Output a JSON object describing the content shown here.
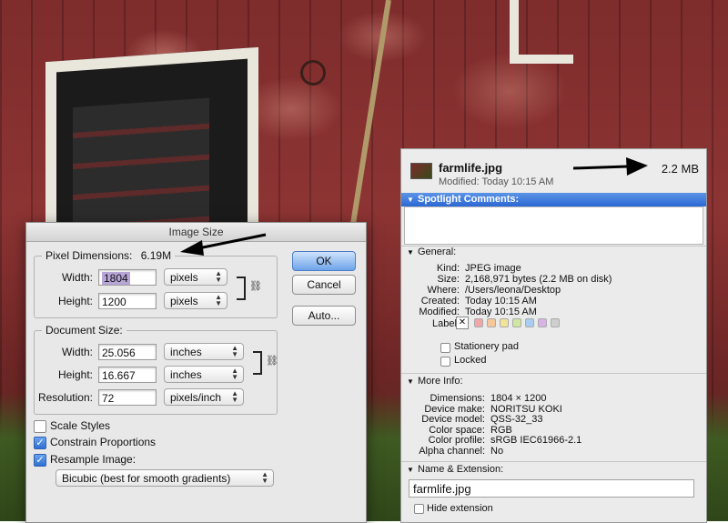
{
  "image_size_dialog": {
    "title": "Image Size",
    "pixel_dimensions": {
      "label": "Pixel Dimensions:",
      "value": "6.19M",
      "width_label": "Width:",
      "width_value": "1804",
      "width_unit": "pixels",
      "height_label": "Height:",
      "height_value": "1200",
      "height_unit": "pixels"
    },
    "document_size": {
      "label": "Document Size:",
      "width_label": "Width:",
      "width_value": "25.056",
      "width_unit": "inches",
      "height_label": "Height:",
      "height_value": "16.667",
      "height_unit": "inches",
      "resolution_label": "Resolution:",
      "resolution_value": "72",
      "resolution_unit": "pixels/inch"
    },
    "buttons": {
      "ok": "OK",
      "cancel": "Cancel",
      "auto": "Auto..."
    },
    "options": {
      "scale_styles": {
        "label": "Scale Styles",
        "checked": false
      },
      "constrain_proportions": {
        "label": "Constrain Proportions",
        "checked": true
      },
      "resample_image": {
        "label": "Resample Image:",
        "checked": true
      }
    },
    "resample_method": "Bicubic (best for smooth gradients)"
  },
  "info_panel": {
    "file_name": "farmlife.jpg",
    "modified_line": "Modified: Today 10:15 AM",
    "size": "2.2 MB",
    "spotlight_title": "Spotlight Comments:",
    "general": {
      "title": "General:",
      "rows": [
        {
          "key": "Kind:",
          "value": "JPEG image"
        },
        {
          "key": "Size:",
          "value": "2,168,971 bytes (2.2 MB on disk)"
        },
        {
          "key": "Where:",
          "value": "/Users/leona/Desktop"
        },
        {
          "key": "Created:",
          "value": "Today 10:15 AM"
        },
        {
          "key": "Modified:",
          "value": "Today 10:15 AM"
        }
      ],
      "label_key": "Label:",
      "label_colors": [
        "#f0a7a7",
        "#f6c79a",
        "#f2e39a",
        "#cfe7a0",
        "#a8cdf0",
        "#d7b3e6",
        "#cfcfcf"
      ],
      "stationery_pad": "Stationery pad",
      "locked": "Locked"
    },
    "more_info": {
      "title": "More Info:",
      "rows": [
        {
          "key": "Dimensions:",
          "value": "1804 × 1200"
        },
        {
          "key": "Device make:",
          "value": "NORITSU KOKI"
        },
        {
          "key": "Device model:",
          "value": "QSS-32_33"
        },
        {
          "key": "Color space:",
          "value": "RGB"
        },
        {
          "key": "Color profile:",
          "value": "sRGB IEC61966-2.1"
        },
        {
          "key": "Alpha channel:",
          "value": "No"
        }
      ]
    },
    "name_extension": {
      "title": "Name & Extension:",
      "value": "farmlife.jpg",
      "hide_extension": "Hide extension"
    }
  },
  "colors": {
    "accent_blue": "#2c68d4",
    "barn_red": "#8c3433"
  }
}
